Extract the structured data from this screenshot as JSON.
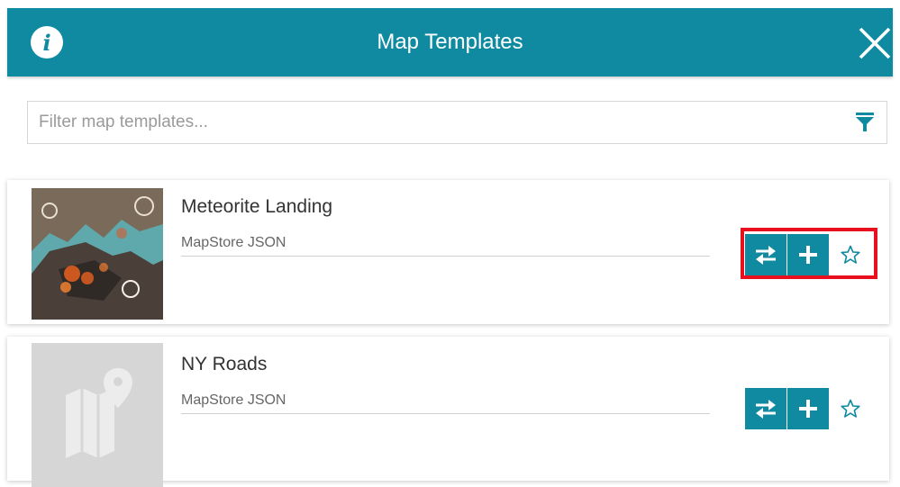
{
  "header": {
    "title": "Map Templates",
    "info_icon": "info-icon",
    "close_icon": "close-icon"
  },
  "filter": {
    "placeholder": "Filter map templates...",
    "value": "",
    "icon": "filter-icon"
  },
  "templates": [
    {
      "title": "Meteorite Landing",
      "format": "MapStore JSON",
      "thumbnail": "map-thumbnail",
      "actions": [
        "replace-icon",
        "add-icon",
        "star-outline-icon"
      ],
      "highlighted": true
    },
    {
      "title": "NY Roads",
      "format": "MapStore JSON",
      "thumbnail": "map-placeholder-icon",
      "actions": [
        "replace-icon",
        "add-icon",
        "star-outline-icon"
      ],
      "highlighted": false
    }
  ],
  "colors": {
    "accent": "#0f8aa0",
    "highlight": "#e8101f",
    "placeholder_bg": "#d6d6d6"
  }
}
